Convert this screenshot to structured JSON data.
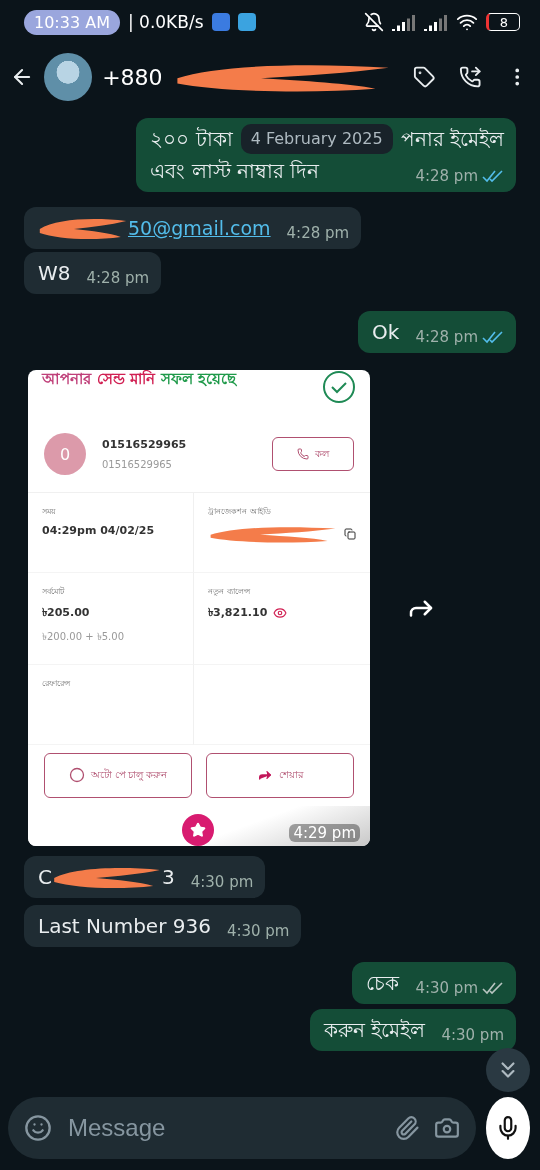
{
  "status_bar": {
    "time": "10:33 AM",
    "network_speed": "| 0.0KB/s",
    "battery": "8"
  },
  "header": {
    "title": "+880",
    "title_redacted": true
  },
  "date_chip": "4 February 2025",
  "messages": [
    {
      "kind": "text",
      "outgoing": true,
      "line_start": "২০০ টাকা",
      "line_end": "পনার ইমেইল",
      "lines": [
        "এবং লাস্ট নাম্বার দিন"
      ],
      "time": "4:28 pm",
      "read": true
    },
    {
      "kind": "link",
      "outgoing": false,
      "redacted": true,
      "text": "50@gmail.com",
      "time": "4:28 pm"
    },
    {
      "kind": "text",
      "outgoing": false,
      "lines": [
        "W8"
      ],
      "time": "4:28 pm"
    },
    {
      "kind": "text",
      "outgoing": true,
      "lines": [
        "Ok"
      ],
      "time": "4:28 pm",
      "read": true
    },
    {
      "kind": "receipt",
      "outgoing": false,
      "time": "4:29 pm",
      "receipt": {
        "title_parts": [
          {
            "text": "আপনার",
            "color": "#c0407a"
          },
          {
            "text": "সেন্ড মানি",
            "color": "#d12053"
          },
          {
            "text": "সফল হয়েছে",
            "color": "#1f9a4a"
          }
        ],
        "avatar": "0",
        "name": "01516529965",
        "number": "01516529965",
        "call_button": "কল",
        "fields": [
          {
            "kind": "plain",
            "label": "সময়",
            "value": "04:29pm 04/02/25"
          },
          {
            "kind": "redacted",
            "label": "ট্রানজেকশন আইডি"
          },
          {
            "kind": "plain",
            "label": "সর্বমোট",
            "value": "৳205.00",
            "sub": "৳200.00 + ৳5.00"
          },
          {
            "kind": "hidden",
            "label": "নতুন ব্যালেন্স",
            "value": "৳3,821.10"
          },
          {
            "kind": "plain",
            "label": "রেফারেন্স"
          },
          {
            "kind": "empty"
          }
        ],
        "buttons": [
          {
            "kind": "autopay",
            "label": "অটো পে চালু করুন"
          },
          {
            "kind": "share",
            "label": "শেয়ার"
          }
        ]
      }
    },
    {
      "kind": "text",
      "outgoing": false,
      "prefix": "C",
      "redacted": true,
      "lines": [
        "3"
      ],
      "time": "4:30 pm"
    },
    {
      "kind": "text",
      "outgoing": false,
      "lines": [
        "Last Number 936"
      ],
      "time": "4:30 pm"
    },
    {
      "kind": "text",
      "outgoing": true,
      "lines": [
        "চেক"
      ],
      "time": "4:30 pm",
      "read": false
    },
    {
      "kind": "text",
      "outgoing": true,
      "lines": [
        "করুন ইমেইল"
      ],
      "time": "4:30 pm"
    }
  ],
  "composer": {
    "placeholder": "Message"
  }
}
